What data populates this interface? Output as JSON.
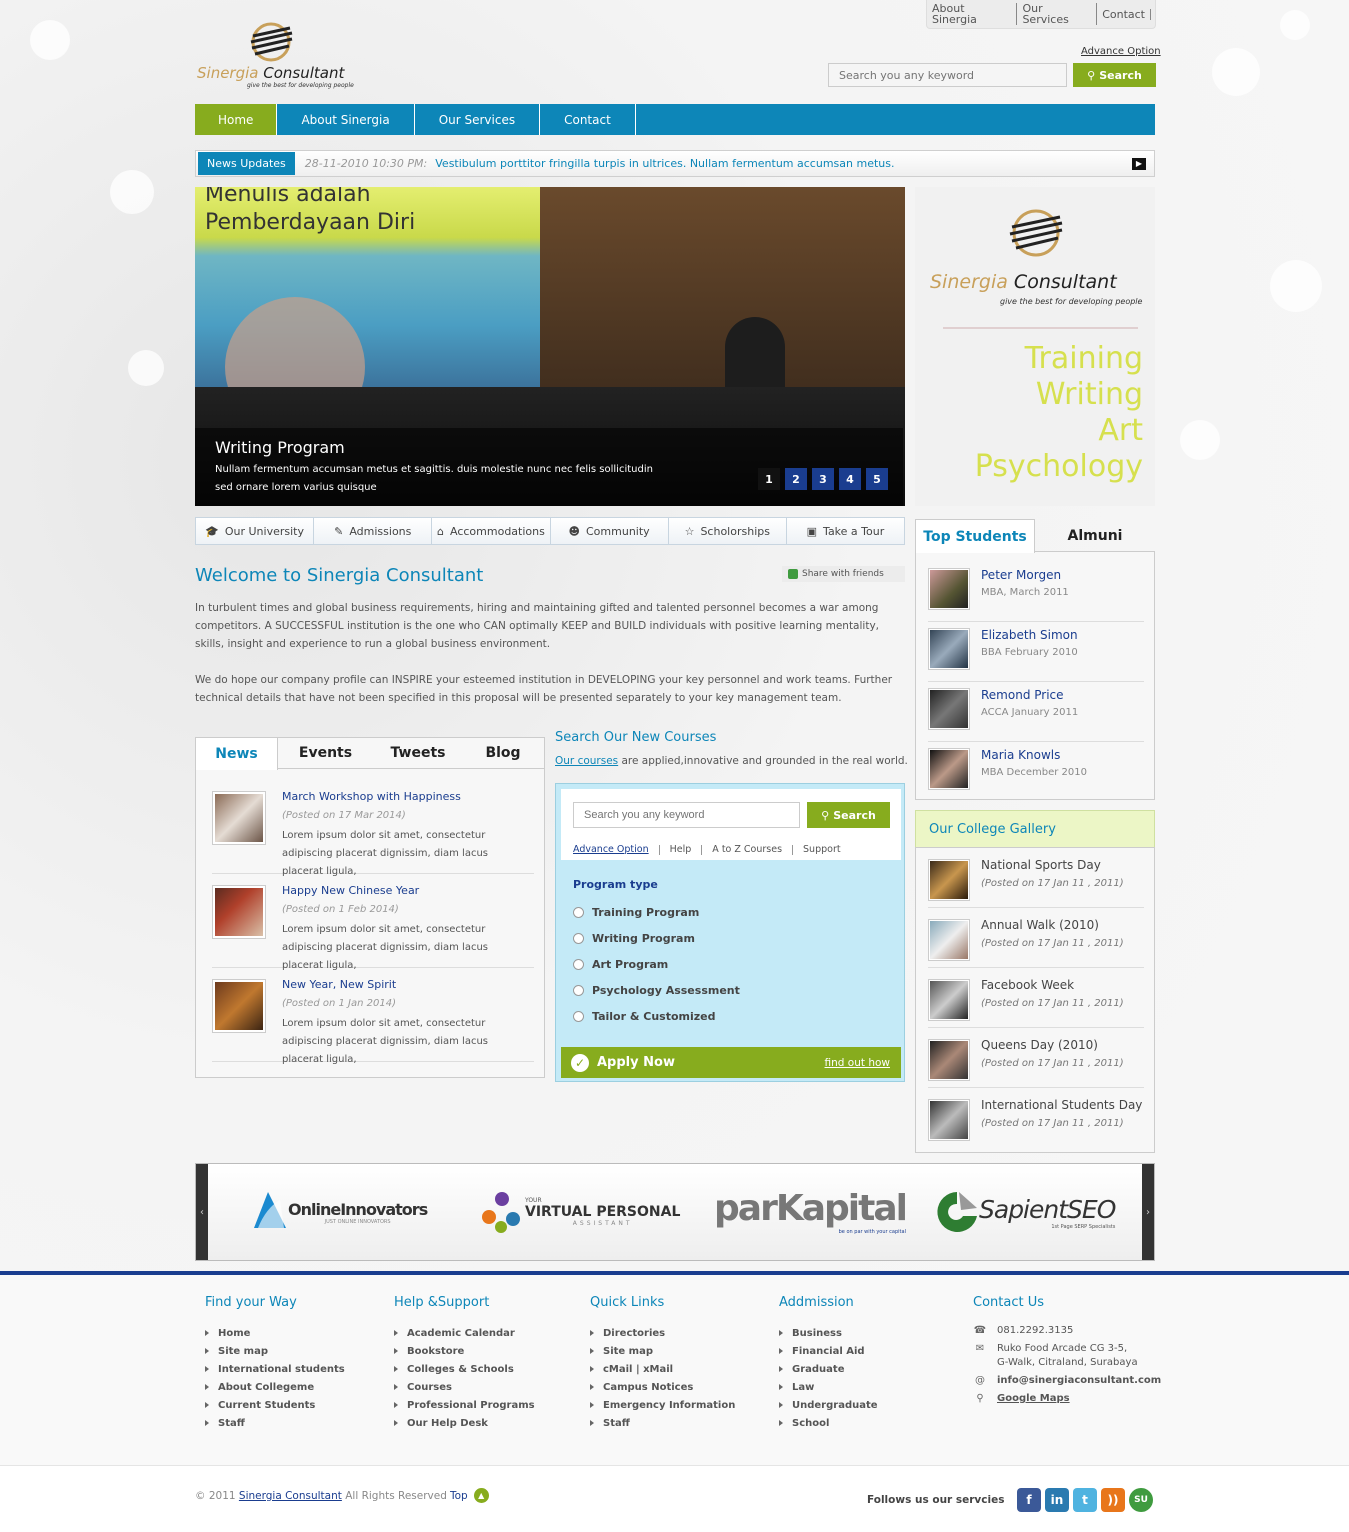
{
  "top_links": [
    "About Sinergia",
    "Our Services",
    "Contact"
  ],
  "header": {
    "advance_option": "Advance Option",
    "search_placeholder": "Search you any keyword",
    "search_label": "Search",
    "logo_name": "Sinergia",
    "logo_name2": "Consultant",
    "logo_tagline": "give the best for developing people"
  },
  "nav": [
    {
      "label": "Home",
      "active": true
    },
    {
      "label": "About Sinergia"
    },
    {
      "label": "Our Services"
    },
    {
      "label": "Contact"
    }
  ],
  "ticker": {
    "label": "News Updates",
    "date": "28-11-2010 10:30 PM:",
    "text": "Vestibulum porttitor fringilla turpis in ultrices. Nullam fermentum accumsan metus."
  },
  "slider": {
    "slide_text_1": "Menulis adalah",
    "slide_text_2": "Pemberdayaan Diri",
    "title": "Writing Program",
    "desc": "Nullam fermentum accumsan metus et sagittis. duis molestie nunc nec felis sollicitudin sed ornare lorem varius quisque",
    "pages": [
      "1",
      "2",
      "3",
      "4",
      "5"
    ],
    "active_page": 1
  },
  "promo": {
    "name": "Sinergia",
    "name2": "Consultant",
    "tagline": "give the best for developing people",
    "words": [
      "Training",
      "Writing",
      "Art",
      "Psychology"
    ]
  },
  "iconbar": [
    {
      "icon": "mortarboard-icon",
      "label": "Our University"
    },
    {
      "icon": "pencil-icon",
      "label": "Admissions"
    },
    {
      "icon": "house-icon",
      "label": "Accommodations"
    },
    {
      "icon": "people-icon",
      "label": "Community"
    },
    {
      "icon": "star-icon",
      "label": "Scholorships"
    },
    {
      "icon": "camera-icon",
      "label": "Take a Tour"
    }
  ],
  "welcome": {
    "title": "Welcome to Sinergia Consultant",
    "share": "Share with friends",
    "p1": "In turbulent times and global business requirements, hiring and maintaining gifted and talented personnel becomes a war among competitors. A SUCCESSFUL institution is the one who CAN optimally KEEP and BUILD individuals with positive learning mentality, skills, insight and experience to run a global business environment.",
    "p2": "We do hope our company profile can INSPIRE your esteemed institution in DEVELOPING your key personnel and work teams. Further technical details that have not been specified in this proposal will be presented separately to your key management team."
  },
  "news_tabs": [
    "News",
    "Events",
    "Tweets",
    "Blog"
  ],
  "news": [
    {
      "title": "March Workshop with Happiness",
      "posted": "(Posted on 17 Mar 2014)",
      "desc": "Lorem ipsum dolor sit amet, consectetur adipiscing placerat dignissim, diam lacus placerat ligula,"
    },
    {
      "title": "Happy New Chinese Year",
      "posted": "(Posted on 1 Feb 2014)",
      "desc": "Lorem ipsum dolor sit amet, consectetur adipiscing placerat dignissim, diam lacus placerat ligula,"
    },
    {
      "title": "New Year, New Spirit",
      "posted": "(Posted on 1 Jan 2014)",
      "desc": "Lorem ipsum dolor sit amet, consectetur adipiscing placerat dignissim, diam lacus placerat ligula,"
    }
  ],
  "courses": {
    "title": "Search Our New Courses",
    "sub_link": "Our courses",
    "sub_rest": " are applied,innovative and grounded in the real world.",
    "placeholder": "Search you any keyword",
    "search_label": "Search",
    "links": [
      "Advance Option",
      "Help",
      "A to Z Courses",
      "Support"
    ],
    "program_type": "Program type",
    "programs": [
      "Training Program",
      "Writing Program",
      "Art Program",
      "Psychology Assessment",
      "Tailor & Customized"
    ],
    "apply": "Apply Now",
    "find_out": "find out how"
  },
  "student_tabs": [
    "Top Students",
    "Almuni"
  ],
  "students": [
    {
      "name": "Peter Morgen",
      "info": "MBA, March 2011"
    },
    {
      "name": "Elizabeth Simon",
      "info": "BBA February 2010"
    },
    {
      "name": "Remond Price",
      "info": "ACCA January 2011"
    },
    {
      "name": "Maria Knowls",
      "info": "MBA December 2010"
    }
  ],
  "gallery": {
    "title": "Our College Gallery",
    "items": [
      {
        "name": "National Sports Day",
        "posted": "(Posted on 17 Jan 11 , 2011)"
      },
      {
        "name": " Annual Walk (2010)",
        "posted": "(Posted on 17 Jan 11 , 2011)"
      },
      {
        "name": " Facebook Week",
        "posted": "(Posted on 17 Jan 11 , 2011)"
      },
      {
        "name": "Queens Day (2010)",
        "posted": "(Posted on 17 Jan 11 , 2011)"
      },
      {
        "name": "International Students Day",
        "posted": "(Posted on 17 Jan 11 , 2011)"
      }
    ]
  },
  "partners": [
    {
      "name": "OnlineInnovators",
      "sub": "JUST ONLINE INNOVATORS"
    },
    {
      "name": "VIRTUAL PERSONAL",
      "pre": "YOUR",
      "sub": "ASSISTANT"
    },
    {
      "name": "parKapital",
      "sub": "be on par with your capital"
    },
    {
      "name": "SapientSEO",
      "sub": "1st Page SERP Specialists"
    }
  ],
  "footer": {
    "cols": [
      {
        "title": "Find your Way",
        "items": [
          "Home",
          "Site map",
          "International students",
          "About Collegeme",
          "Current Students",
          "Staff"
        ]
      },
      {
        "title": "Help &Support",
        "items": [
          "Academic Calendar",
          "Bookstore",
          "Colleges & Schools",
          "Courses",
          "Professional Programs",
          "Our Help Desk"
        ]
      },
      {
        "title": "Quick Links",
        "items": [
          "Directories",
          "Site map",
          "cMail | xMail",
          "Campus Notices",
          "Emergency Information",
          "Staff"
        ]
      },
      {
        "title": "Addmission",
        "items": [
          "Business",
          "Financial Aid",
          "Graduate",
          "Law",
          "Undergraduate",
          "School"
        ]
      }
    ],
    "contact": {
      "title": "Contact Us",
      "phone": "081.2292.3135",
      "addr1": "Ruko Food Arcade CG 3-5,",
      "addr2": "G-Walk, Citraland, Surabaya",
      "email": "info@sinergiaconsultant.com",
      "maps": "Google Maps"
    }
  },
  "bottom": {
    "copy": "© 2011 ",
    "company": "Sinergia Consultant",
    "rights": " All Rights Reserved",
    "top": "Top",
    "follow": "Follows us our servcies"
  },
  "social": [
    {
      "icon": "facebook-icon",
      "glyph": "f",
      "color": "#3b5998"
    },
    {
      "icon": "linkedin-icon",
      "glyph": "in",
      "color": "#2a7ab0"
    },
    {
      "icon": "twitter-icon",
      "glyph": "t",
      "color": "#4fb3e0"
    },
    {
      "icon": "rss-icon",
      "glyph": "))",
      "color": "#e8761b"
    },
    {
      "icon": "stumbleupon-icon",
      "glyph": "SU",
      "color": "#3f9b3f"
    }
  ],
  "colors": {
    "accent_blue": "#0d86b8",
    "accent_green": "#87ac1e",
    "navy": "#1a3d8f"
  }
}
